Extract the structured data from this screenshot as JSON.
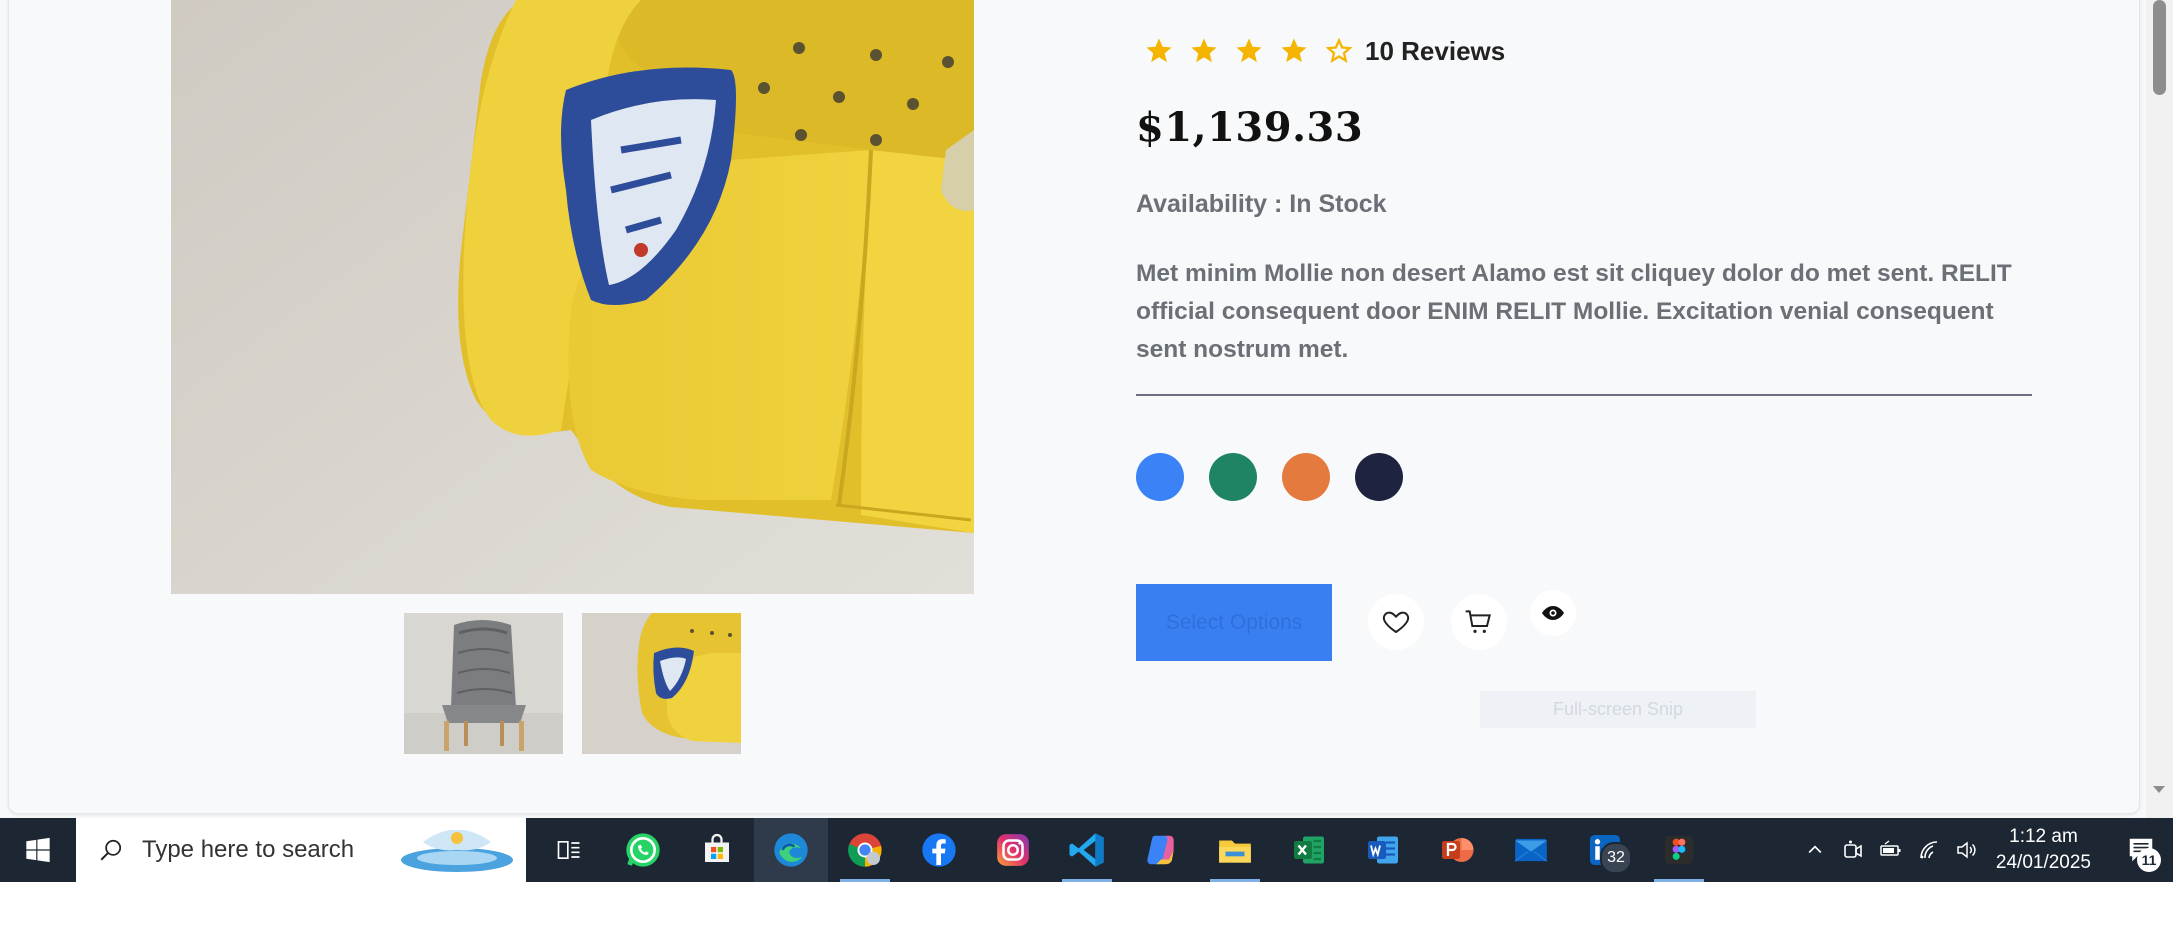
{
  "product": {
    "rating": 4,
    "rating_max": 5,
    "reviews_label": "10 Reviews",
    "price": "$1,139.33",
    "availability": "Availability : In Stock",
    "description": "Met minim Mollie non desert Alamo est sit cliquey dolor do met sent. RELIT official consequent door ENIM RELIT Mollie. Excitation venial consequent sent nostrum met.",
    "colors": [
      "#3b82f6",
      "#1f8463",
      "#e57a3e",
      "#1e2440"
    ],
    "select_label": "Select Options"
  },
  "tooltip": {
    "text": "Full-screen Snip"
  },
  "taskbar": {
    "search_placeholder": "Type here to search",
    "linkedin_badge": "32",
    "time": "1:12 am",
    "date": "24/01/2025",
    "notification_count": "11"
  }
}
